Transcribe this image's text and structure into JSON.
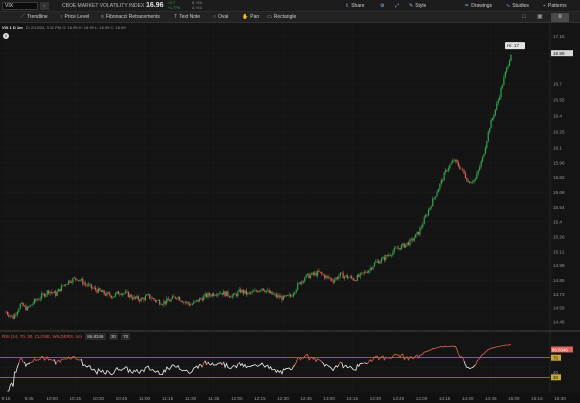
{
  "topbar": {
    "symbol": "VIX",
    "symbol_badge": "▪",
    "symbol_name": "CBOE MARKET VOLATILITY INDEX",
    "last_price": "16.96",
    "change": "+0.7",
    "change_pct": "+1.77%",
    "bid": "B: N/A",
    "ask": "A: N/A",
    "buttons": [
      "Share",
      "Style",
      "Drawings",
      "Studies",
      "Patterns"
    ],
    "button_icons": [
      "share-icon",
      "style-icon",
      "drawings-icon",
      "studies-icon",
      "patterns-icon"
    ]
  },
  "drawbar": {
    "tools": [
      "Trendline",
      "Price Level",
      "Fibonacci Retracements",
      "Text Note",
      "Oval",
      "Pan",
      "Rectangle"
    ],
    "sidebar_toggle": "≡"
  },
  "chart_header": {
    "label": "VIX 1 D 1m",
    "ohlc": "D: 2/13/24, 3:11 PM   O: 16.99   H: 16.99   L: 16.99   C: 16.99"
  },
  "hi_label": "Hi: 17",
  "rsi_header": {
    "label": "RSI (14, 70, 30, CLOSE, WILDERS, no)",
    "value": "86.8346",
    "overbought": "30",
    "oversold": "70"
  },
  "rsi_value_label": "86.8346",
  "chart_data": {
    "type": "candlestick",
    "price_axis_labels": [
      "17.15",
      "16.99",
      "16.7",
      "16.55",
      "16.4",
      "16.25",
      "16.1",
      "15.96",
      "15.82",
      "15.68",
      "15.54",
      "15.4",
      "15.26",
      "15.12",
      "14.99",
      "14.85",
      "14.72",
      "14.59",
      "14.46"
    ],
    "price_range": [
      14.4,
      17.18
    ],
    "time_axis_labels": [
      "9:15",
      "9:45",
      "10:00",
      "10:15",
      "10:30",
      "10:45",
      "11:00",
      "11:15",
      "11:30",
      "11:45",
      "12:00",
      "12:15",
      "12:30",
      "12:45",
      "13:00",
      "13:15",
      "13:30",
      "13:45",
      "14:00",
      "14:15",
      "14:30",
      "14:45",
      "15:00",
      "15:15",
      "15:30"
    ],
    "last_price_label": "16.99",
    "closes_every_5min": [
      14.55,
      14.5,
      14.62,
      14.58,
      14.65,
      14.7,
      14.75,
      14.72,
      14.8,
      14.85,
      14.87,
      14.82,
      14.78,
      14.75,
      14.72,
      14.7,
      14.74,
      14.72,
      14.68,
      14.67,
      14.7,
      14.66,
      14.64,
      14.66,
      14.7,
      14.65,
      14.62,
      14.66,
      14.7,
      14.72,
      14.74,
      14.72,
      14.7,
      14.75,
      14.72,
      14.74,
      14.78,
      14.73,
      14.7,
      14.68,
      14.7,
      14.8,
      14.88,
      14.9,
      14.92,
      14.88,
      14.85,
      14.9,
      14.88,
      14.86,
      14.9,
      14.95,
      15.02,
      15.05,
      15.1,
      15.15,
      15.18,
      15.22,
      15.3,
      15.45,
      15.6,
      15.75,
      15.9,
      15.98,
      15.9,
      15.78,
      15.8,
      16.0,
      16.3,
      16.5,
      16.75,
      16.99
    ],
    "rsi_levels": [
      "86.8346",
      "70",
      "30"
    ],
    "rsi_ylim": [
      0,
      100
    ]
  }
}
